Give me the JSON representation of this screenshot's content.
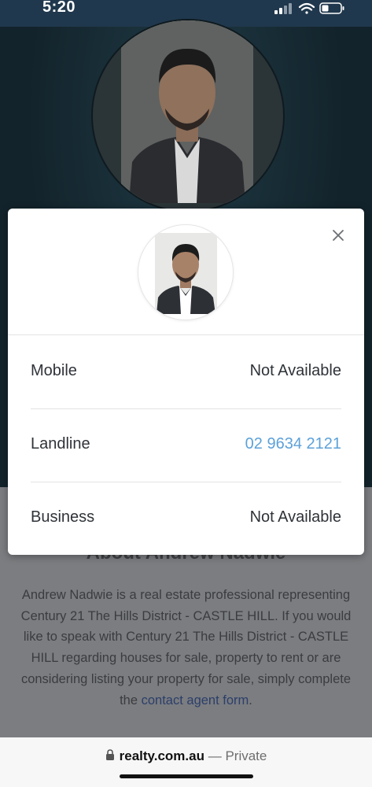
{
  "status_bar": {
    "time": "5:20",
    "icons": [
      "signal-icon",
      "wifi-icon",
      "battery-icon"
    ]
  },
  "modal": {
    "close_icon": "close-icon",
    "rows": [
      {
        "label": "Mobile",
        "value": "Not Available",
        "is_link": false
      },
      {
        "label": "Landline",
        "value": "02 9634 2121",
        "is_link": true
      },
      {
        "label": "Business",
        "value": "Not Available",
        "is_link": false
      }
    ]
  },
  "about": {
    "title": "About Andrew Nadwie",
    "text_before_link": "Andrew Nadwie is a real estate professional representing Century 21 The Hills District - CASTLE HILL. If you would like to speak with Century 21 The Hills District - CASTLE HILL regarding houses for sale, property to rent or are considering listing your property for sale, simply complete the ",
    "link_text": "contact agent form",
    "text_after_link": "."
  },
  "browser": {
    "lock_icon": "lock-icon",
    "domain": "realty.com.au",
    "separator": " — ",
    "privacy": "Private"
  },
  "colors": {
    "link": "#5da1d9",
    "status_bar_bg": "#20384d",
    "modal_bg": "#ffffff"
  }
}
